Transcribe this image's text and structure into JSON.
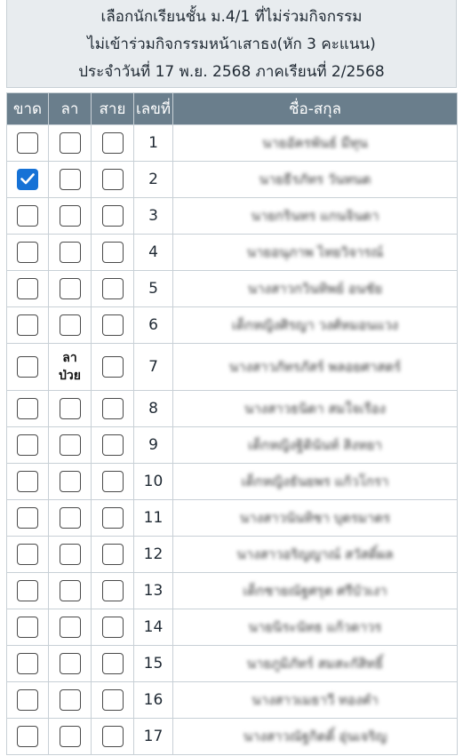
{
  "header": {
    "line1": "เลือกนักเรียนชั้น ม.4/1 ที่ไม่ร่วมกิจกรรม",
    "line2": "ไม่เข้าร่วมกิจกรรมหน้าเสาธง(หัก 3 คะแนน)",
    "line3": "ประจำวันที่ 17 พ.ย. 2568 ภาคเรียนที่ 2/2568"
  },
  "table": {
    "col_absent": "ขาด",
    "col_leave": "ลา",
    "col_late": "สาย",
    "col_number": "เลขที่",
    "col_name": "ชื่อ-สกุล"
  },
  "rows": [
    {
      "no": "1",
      "name": "นายอัครพันธ์ มีทุน",
      "absent": false,
      "late": false
    },
    {
      "no": "2",
      "name": "นายธีรภัทร วันทนต",
      "absent": true,
      "late": false
    },
    {
      "no": "3",
      "name": "นายกรินทร แกนจินดา",
      "absent": false,
      "late": false
    },
    {
      "no": "4",
      "name": "นายอนุภาพ ไทยวิจารณ์",
      "absent": false,
      "late": false
    },
    {
      "no": "5",
      "name": "นางสาวกวินทิพย์ อนชัย",
      "absent": false,
      "late": false
    },
    {
      "no": "6",
      "name": "เด็กหญิงศิรญา วงศ์หมอนแวง",
      "absent": false,
      "late": false
    },
    {
      "no": "7",
      "name": "นางสาวภัทรภัสร์ พลอยศาสตร์",
      "absent": false,
      "late": false,
      "leave_text": "ลา ป่วย"
    },
    {
      "no": "8",
      "name": "นางสาวธนิดา สมใจเรือง",
      "absent": false,
      "late": false
    },
    {
      "no": "9",
      "name": "เด็กหญิงฐิตินันท์ สิงหยา",
      "absent": false,
      "late": false
    },
    {
      "no": "10",
      "name": "เด็กหญิงธันยพร แก้วโกรา",
      "absent": false,
      "late": false
    },
    {
      "no": "11",
      "name": "นางสาวนันทิชา บุตรมาตร",
      "absent": false,
      "late": false
    },
    {
      "no": "12",
      "name": "นางสาวอริญญาณ์ สวัสดิ์ผล",
      "absent": false,
      "late": false
    },
    {
      "no": "13",
      "name": "เด็กชายณัฐศรุต ศรีบัวเงา",
      "absent": false,
      "late": false
    },
    {
      "no": "14",
      "name": "นายนิระนัทธ แก้วดาวร",
      "absent": false,
      "late": false
    },
    {
      "no": "15",
      "name": "นายภูมิภัทร์ สมสะกัสิทธิ์",
      "absent": false,
      "late": false
    },
    {
      "no": "16",
      "name": "นางสาวเมธาวี ทองคำ",
      "absent": false,
      "late": false
    },
    {
      "no": "17",
      "name": "นางสาวณัฐกิตติ์ อุ่นเจริญ",
      "absent": false,
      "late": false
    }
  ],
  "colors": {
    "header_bg": "#e8ecef",
    "table_header_bg": "#6a7e8c",
    "checkbox_checked": "#1672d6"
  }
}
